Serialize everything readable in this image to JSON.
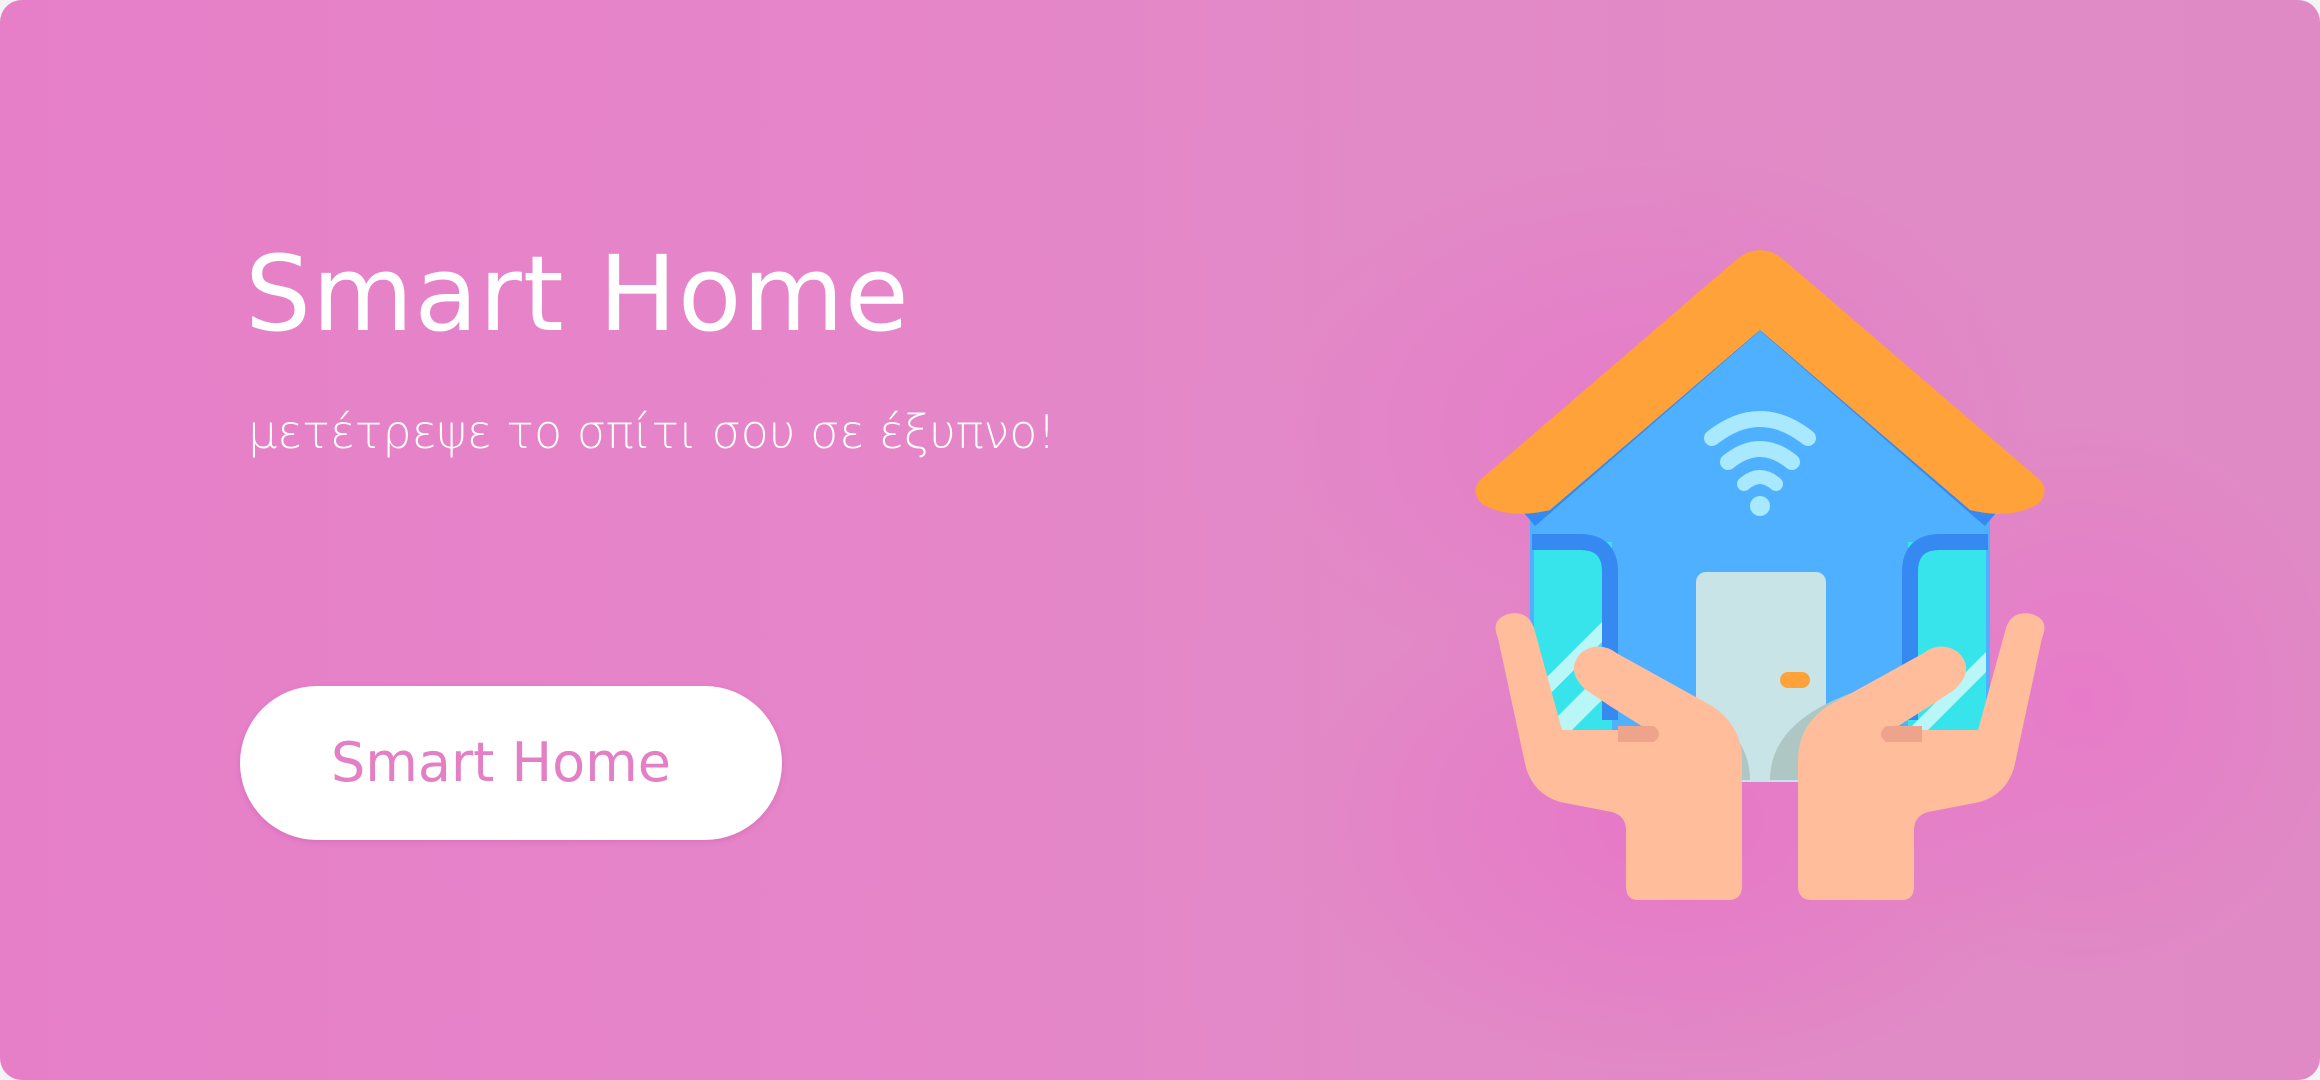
{
  "banner": {
    "title": "Smart Home",
    "subtitle": "μετέτρεψε το σπίτι σου σε έξυπνο!",
    "cta_label": "Smart Home",
    "illustration_icon": "smart-home-hands-icon"
  },
  "colors": {
    "background": "#e685c9",
    "glow": "#ec6ac8",
    "text": "#ffffff",
    "cta_background": "#ffffff",
    "cta_text": "#e47fc6",
    "roof": "#ffa23a",
    "house_wall": "#4fb0ff",
    "house_outline": "#3589f0",
    "window": "#37e4ec",
    "door": "#c8e4e6",
    "wifi": "#a9e9ff",
    "hands": "#ffbd9c"
  }
}
